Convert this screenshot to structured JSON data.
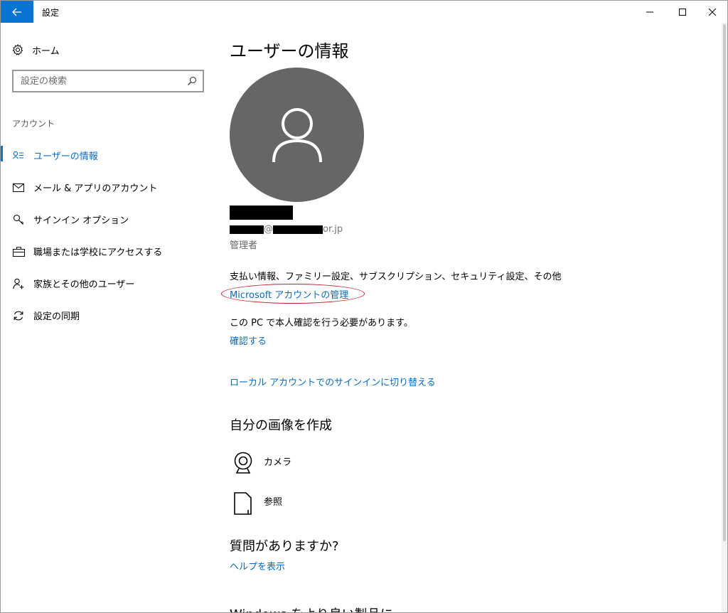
{
  "window": {
    "title": "設定",
    "accent_color": "#0a74d2"
  },
  "sidebar": {
    "home_label": "ホーム",
    "search_placeholder": "設定の検索",
    "section_heading": "アカウント",
    "items": [
      {
        "label": "ユーザーの情報",
        "icon": "user-list-icon",
        "active": true
      },
      {
        "label": "メール & アプリのアカウント",
        "icon": "mail-icon",
        "active": false
      },
      {
        "label": "サインイン オプション",
        "icon": "key-icon",
        "active": false
      },
      {
        "label": "職場または学校にアクセスする",
        "icon": "briefcase-icon",
        "active": false
      },
      {
        "label": "家族とその他のユーザー",
        "icon": "add-user-icon",
        "active": false
      },
      {
        "label": "設定の同期",
        "icon": "sync-icon",
        "active": false
      }
    ]
  },
  "main": {
    "title": "ユーザーの情報",
    "email_visible_parts": {
      "at": "@",
      "suffix": "or.jp"
    },
    "role": "管理者",
    "billing_text": "支払い情報、ファミリー設定、サブスクリプション、セキュリティ設定、その他",
    "manage_account_link": "Microsoft アカウントの管理",
    "verify_text": "この PC で本人確認を行う必要があります。",
    "verify_link": "確認する",
    "local_account_link": "ローカル アカウントでのサインインに切り替える",
    "create_picture_heading": "自分の画像を作成",
    "camera_label": "カメラ",
    "browse_label": "参照",
    "question_heading": "質問がありますか?",
    "help_link": "ヘルプを表示",
    "feedback_heading": "Windows をより良い製品に"
  }
}
